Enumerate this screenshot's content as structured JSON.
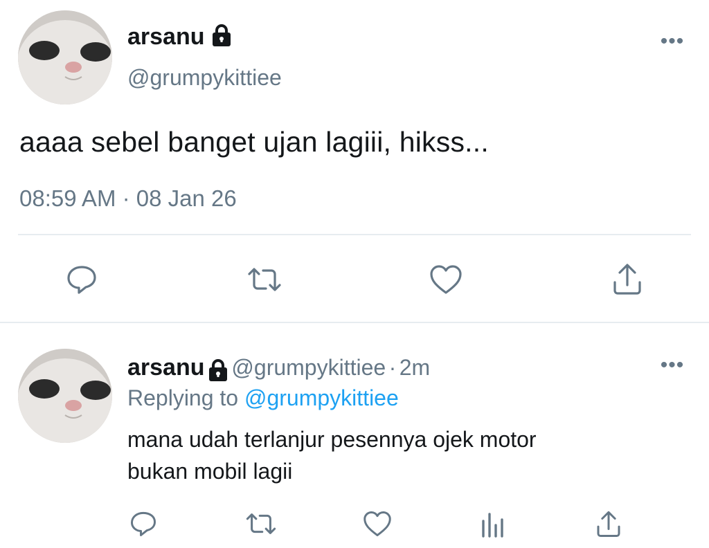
{
  "main_tweet": {
    "display_name": "arsanu",
    "handle": "@grumpykittiee",
    "text": "aaaa sebel banget ujan lagiii, hikss...",
    "time": "08:59 AM",
    "separator": "·",
    "date": "08 Jan 26",
    "more_label": "•••",
    "icons": [
      "reply-icon",
      "retweet-icon",
      "like-icon",
      "share-icon"
    ],
    "avatar_icon": "cat-avatar"
  },
  "reply_tweet": {
    "display_name": "arsanu",
    "handle": "@grumpykittiee",
    "separator": "·",
    "age": "2m",
    "replying_prefix": "Replying to",
    "replying_handle": "@grumpykittiee",
    "text_line1": "mana udah terlanjur pesennya ojek motor",
    "text_line2": "bukan mobil lagii",
    "more_label": "•••",
    "icons": [
      "reply-icon",
      "retweet-icon",
      "like-icon",
      "analytics-icon",
      "share-icon"
    ]
  },
  "colors": {
    "text": "#14171a",
    "secondary": "#657786",
    "link": "#1da1f2",
    "divider": "#e6ecf0"
  }
}
